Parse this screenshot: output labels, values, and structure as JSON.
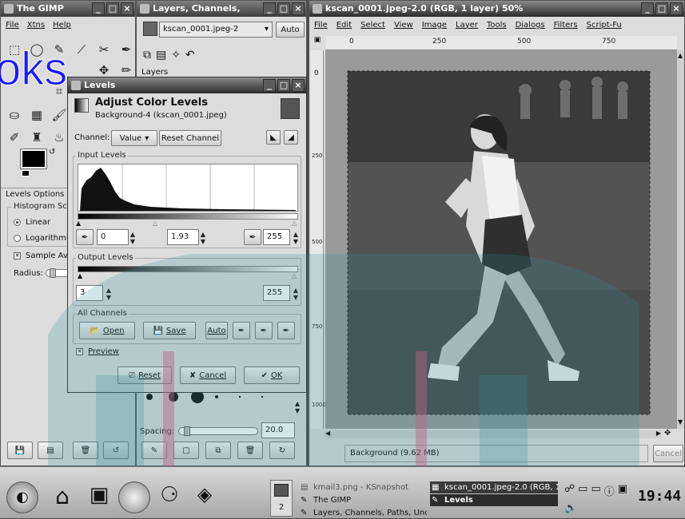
{
  "colors": {
    "teal": "#2f8f9d",
    "pink": "#c06080",
    "title_dark": "#2c2c2c"
  },
  "toolbox": {
    "title": "The GIMP",
    "menu": [
      "File",
      "Xtns",
      "Help"
    ],
    "options_title": "Levels Options",
    "histogram_scale": "Histogram Sca",
    "linear": "Linear",
    "logarithmic": "Logarithmi",
    "sample_average": "Sample Av",
    "radius": "Radius:"
  },
  "layers_dialog": {
    "title": "Layers, Channels,",
    "image_select": "kscan_0001.jpeg-2",
    "auto": "Auto",
    "tab_label": "Layers",
    "spacing_label": "Spacing:",
    "spacing_value": "20.0"
  },
  "levels": {
    "title": "Levels",
    "heading": "Adjust Color Levels",
    "subheading": "Background-4 (kscan_0001.jpeg)",
    "channel_label": "Channel:",
    "channel_value": "Value",
    "reset_channel": "Reset Channel",
    "input_levels": "Input Levels",
    "input_low": "0",
    "gamma": "1.93",
    "input_high": "255",
    "output_levels": "Output Levels",
    "output_low": "3",
    "output_high": "255",
    "all_channels": "All Channels",
    "open": "Open",
    "save": "Save",
    "auto": "Auto",
    "preview": "Preview",
    "reset": "Reset",
    "cancel": "Cancel",
    "ok": "OK"
  },
  "image_window": {
    "title": "kscan_0001.jpeg-2.0 (RGB, 1 layer) 50%",
    "menu": [
      "File",
      "Edit",
      "Select",
      "View",
      "Image",
      "Layer",
      "Tools",
      "Dialogs",
      "Filters",
      "Script-Fu"
    ],
    "ruler_h": [
      "0",
      "250",
      "500",
      "750"
    ],
    "ruler_v": [
      "0",
      "250",
      "500",
      "750",
      "1000"
    ],
    "status": "Background (9.62 MB)",
    "cancel": "Cancel"
  },
  "taskbar": {
    "pager": "2",
    "tasks": [
      "kmail3.png - KSnapshot",
      "kscan_0001.jpeg-2.0 (RGB, 1",
      "The GIMP",
      "Levels",
      "Layers, Channels, Paths, Undo"
    ],
    "clock": "19:44"
  },
  "overlay": {
    "watermark": "oks"
  }
}
